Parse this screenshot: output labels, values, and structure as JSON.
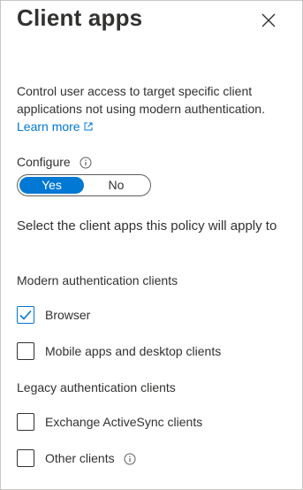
{
  "header": {
    "title": "Client apps"
  },
  "description": {
    "text": "Control user access to target specific client applications not using modern authentication.",
    "learn_more": "Learn more"
  },
  "configure": {
    "label": "Configure",
    "options": {
      "yes": "Yes",
      "no": "No"
    },
    "selected": "Yes"
  },
  "select_text": "Select the client apps this policy will apply to",
  "modern": {
    "label": "Modern authentication clients",
    "items": [
      {
        "label": "Browser",
        "checked": true
      },
      {
        "label": "Mobile apps and desktop clients",
        "checked": false
      }
    ]
  },
  "legacy": {
    "label": "Legacy authentication clients",
    "items": [
      {
        "label": "Exchange ActiveSync clients",
        "checked": false
      },
      {
        "label": "Other clients",
        "checked": false
      }
    ]
  },
  "colors": {
    "accent": "#0078d4",
    "text": "#323130",
    "border": "#c8c6c4"
  }
}
